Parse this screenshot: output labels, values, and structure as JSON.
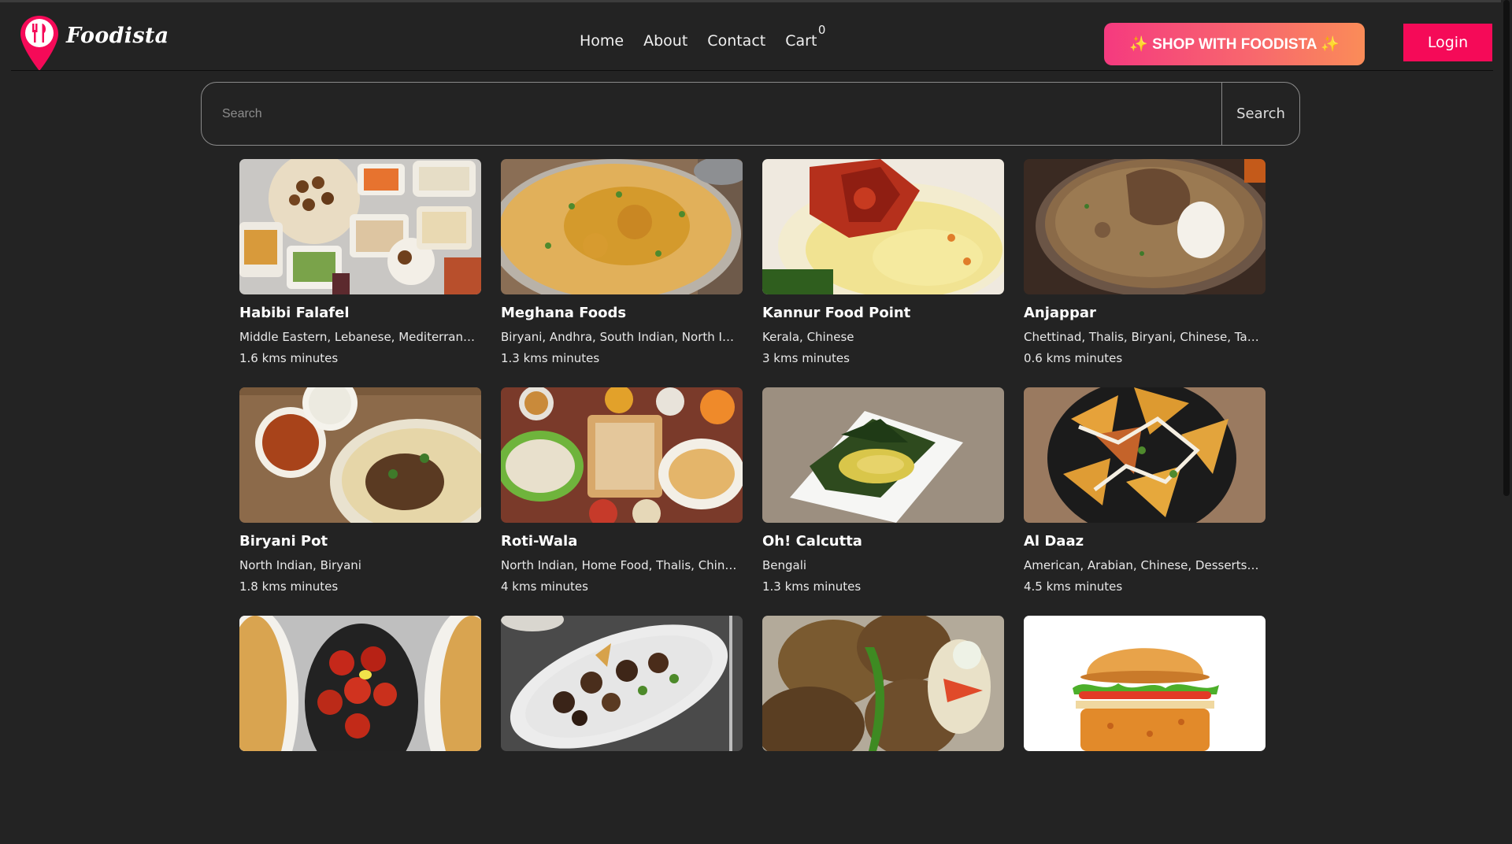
{
  "header": {
    "brand": "Foodista",
    "nav": [
      {
        "label": "Home"
      },
      {
        "label": "About"
      },
      {
        "label": "Contact"
      },
      {
        "label": "Cart"
      }
    ],
    "cart_count": "0",
    "shop_button": "✨ SHOP WITH FOODISTA ✨",
    "login_button": "Login",
    "brand_color": "#f50a58"
  },
  "search": {
    "placeholder": "Search",
    "button": "Search"
  },
  "restaurants": [
    {
      "name": "Habibi Falafel",
      "cuisine": "Middle Eastern, Lebanese, Mediterranean, Arabian",
      "distance": "1.6 kms minutes",
      "image": "falafel-platter"
    },
    {
      "name": "Meghana Foods",
      "cuisine": "Biryani, Andhra, South Indian, North Indian, Chinese",
      "distance": "1.3 kms minutes",
      "image": "biryani-bowl"
    },
    {
      "name": "Kannur Food Point",
      "cuisine": "Kerala, Chinese",
      "distance": "3 kms minutes",
      "image": "chicken-rice"
    },
    {
      "name": "Anjappar",
      "cuisine": "Chettinad, Thalis, Biryani, Chinese, Tandoor, Seafood",
      "distance": "0.6 kms minutes",
      "image": "mutton-biryani-pot"
    },
    {
      "name": "Biryani Pot",
      "cuisine": "North Indian, Biryani",
      "distance": "1.8 kms minutes",
      "image": "biryani-plate"
    },
    {
      "name": "Roti-Wala",
      "cuisine": "North Indian, Home Food, Thalis, Chinese, Desserts",
      "distance": "4 kms minutes",
      "image": "thali-spread"
    },
    {
      "name": "Oh! Calcutta",
      "cuisine": "Bengali",
      "distance": "1.3 kms minutes",
      "image": "banana-leaf-fish"
    },
    {
      "name": "Al Daaz",
      "cuisine": "American, Arabian, Chinese, Desserts, Mughlai",
      "distance": "4.5 kms minutes",
      "image": "loaded-nachos"
    },
    {
      "name": "",
      "cuisine": "",
      "distance": "",
      "image": "chicken-65"
    },
    {
      "name": "",
      "cuisine": "",
      "distance": "",
      "image": "mutton-fry"
    },
    {
      "name": "",
      "cuisine": "",
      "distance": "",
      "image": "grilled-chicken"
    },
    {
      "name": "",
      "cuisine": "",
      "distance": "",
      "image": "burger"
    }
  ]
}
